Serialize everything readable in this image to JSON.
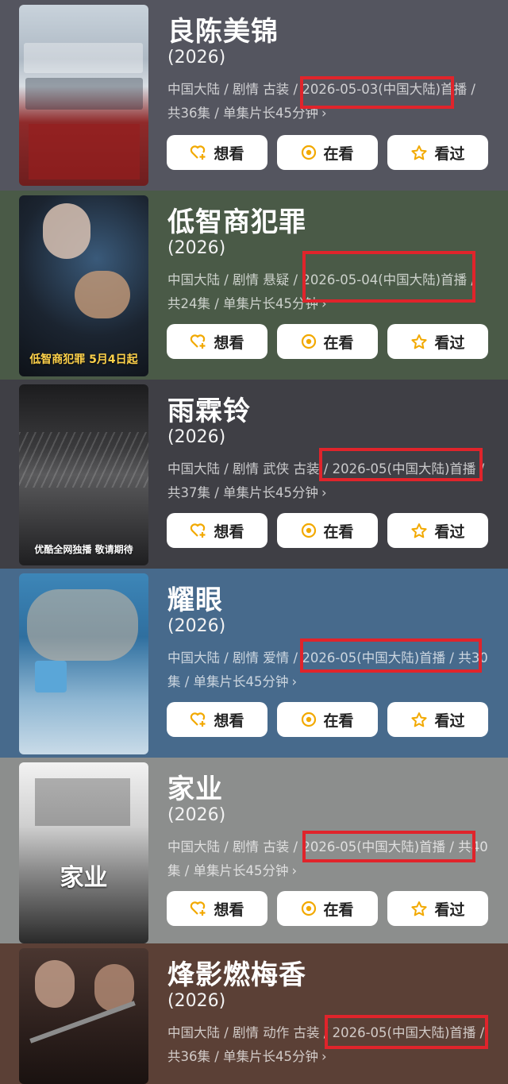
{
  "buttons": {
    "want": "想看",
    "watching": "在看",
    "watched": "看过"
  },
  "colors": {
    "highlight": "#e0242b",
    "button_icon": "#f2a900"
  },
  "items": [
    {
      "title": "良陈美锦",
      "year": "(2026)",
      "meta": "中国大陆 / 剧情 古装 / 2026-05-03(中国大陆)首播 / 共36集 / 单集片长45分钟",
      "highlighted": "2026-05-03(中国大陆)",
      "background": "#54555f"
    },
    {
      "title": "低智商犯罪",
      "year": "(2026)",
      "meta": "中国大陆 / 剧情 悬疑 / 2026-05-04(中国大陆)首播 / 共24集 / 单集片长45分钟",
      "highlighted": "2026-05-04(中国大陆)首",
      "poster_text": "低智商犯罪  5月4日起",
      "background": "#4a5a47"
    },
    {
      "title": "雨霖铃",
      "year": "(2026)",
      "meta": "中国大陆 / 剧情 武侠 古装 / 2026-05(中国大陆)首播 / 共37集 / 单集片长45分钟",
      "highlighted": "/ 2026-05(中国大陆)首",
      "poster_text": "优酷全网独播 敬请期待",
      "background": "#3f3f45"
    },
    {
      "title": "耀眼",
      "year": "(2026)",
      "meta": "中国大陆 / 剧情 爱情 / 2026-05(中国大陆)首播 / 共30集 / 单集片长45分钟",
      "highlighted": "2026-05(中国大陆)首播 /",
      "background": "#476a8c"
    },
    {
      "title": "家业",
      "year": "(2026)",
      "meta": "中国大陆 / 剧情 古装 / 2026-05(中国大陆)首播 / 共40集 / 单集片长45分钟",
      "highlighted": "2026-05(中国大陆)首播",
      "poster_text": "家业",
      "background": "#8c8e8d"
    },
    {
      "title": "烽影燃梅香",
      "year": "(2026)",
      "meta": "中国大陆 / 剧情 动作 古装 / 2026-05(中国大陆)首播 / 共36集 / 单集片长45分钟",
      "highlighted": "/ 2026-05(中国大陆)首",
      "background": "#5b4036"
    }
  ]
}
